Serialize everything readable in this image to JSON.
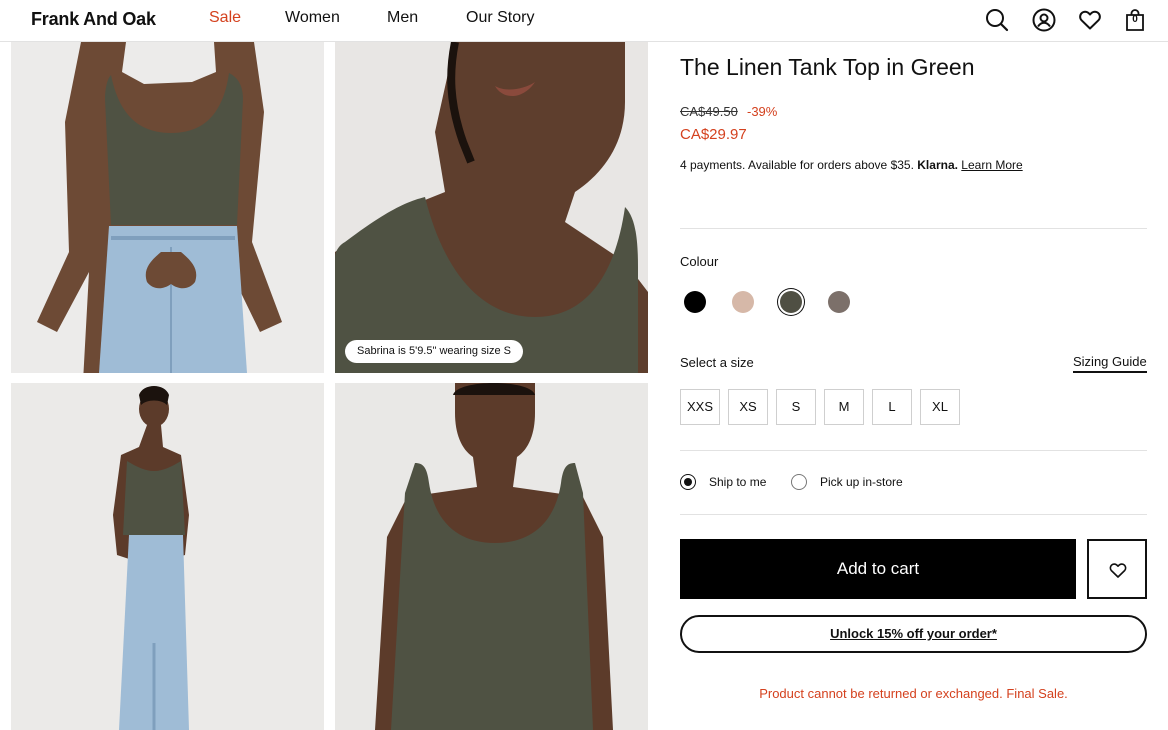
{
  "header": {
    "brand": "Frank And Oak",
    "nav": [
      {
        "label": "Sale"
      },
      {
        "label": "Women"
      },
      {
        "label": "Men"
      },
      {
        "label": "Our Story"
      }
    ],
    "icons": [
      "search-icon",
      "account-icon",
      "wishlist-icon",
      "cart-icon"
    ],
    "cart_count": "0"
  },
  "gallery": {
    "model_tag": "Sabrina is 5'9.5\" wearing size S"
  },
  "product": {
    "title": "The Linen Tank Top in Green",
    "original_price": "CA$49.50",
    "discount": "-39%",
    "sale_price": "CA$29.97",
    "payments_text": "4 payments. Available for orders above $35. ",
    "klarna": "Klarna.",
    "learn_more": "Learn More",
    "colour_label": "Colour",
    "colours": [
      {
        "name": "black",
        "hex": "#000000",
        "selected": false
      },
      {
        "name": "beige",
        "hex": "#d6b8a8",
        "selected": false
      },
      {
        "name": "green",
        "hex": "#4f4f43",
        "selected": true
      },
      {
        "name": "taupe",
        "hex": "#7c706a",
        "selected": false
      }
    ],
    "size_label": "Select a size",
    "sizing_guide": "Sizing Guide",
    "sizes": [
      "XXS",
      "XS",
      "S",
      "M",
      "L",
      "XL"
    ],
    "delivery": [
      {
        "label": "Ship to me",
        "checked": true
      },
      {
        "label": "Pick up in-store",
        "checked": false
      }
    ],
    "add_to_cart": "Add to cart",
    "unlock": "Unlock 15% off your order*",
    "final_sale": "Product cannot be returned or exchanged. Final Sale."
  },
  "colors": {
    "accent_red": "#d4411e",
    "top_green": "#4f5243",
    "denim": "#9fbcd6"
  }
}
